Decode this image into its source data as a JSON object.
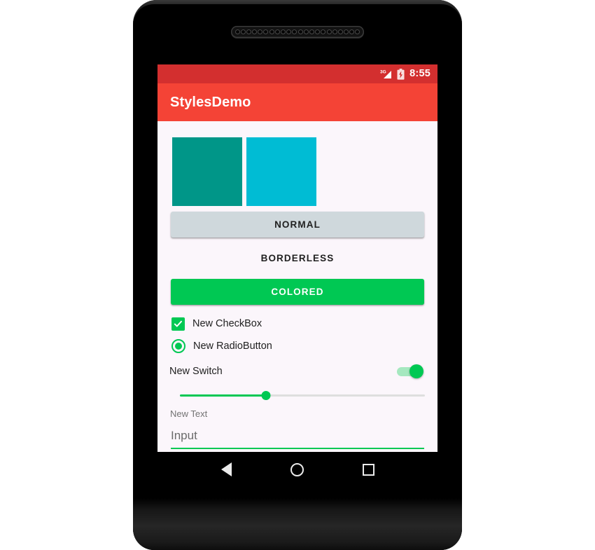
{
  "device": {
    "name": "android-phone-frame",
    "speaker_hole_count": 22
  },
  "status_bar": {
    "network_label": "3G",
    "signal_icon": "signal-bars-icon",
    "battery_icon": "battery-charging-icon",
    "clock": "8:55",
    "background": "#D32F2F"
  },
  "app_bar": {
    "title": "StylesDemo",
    "background": "#F44336",
    "text_color": "#FFFFFF"
  },
  "content": {
    "background": "#FBF6FB",
    "swatches": [
      {
        "name": "teal-swatch",
        "color": "#009688"
      },
      {
        "name": "cyan-swatch",
        "color": "#00BCD4"
      }
    ],
    "buttons": {
      "normal": {
        "label": "NORMAL",
        "background": "#CFD8DC",
        "text_color": "#212121"
      },
      "borderless": {
        "label": "BORDERLESS",
        "background": "transparent",
        "text_color": "#212121"
      },
      "colored": {
        "label": "COLORED",
        "background": "#00C853",
        "text_color": "#FFFFFF"
      }
    },
    "checkbox": {
      "label": "New CheckBox",
      "checked": true,
      "accent": "#00C853"
    },
    "radio": {
      "label": "New RadioButton",
      "selected": true,
      "accent": "#00C853"
    },
    "switch": {
      "label": "New Switch",
      "on": true,
      "accent": "#00C853",
      "track_color": "#A5E8BF"
    },
    "seekbar": {
      "name": "New SeekBar",
      "value_percent": 35,
      "accent": "#00C853",
      "track_color": "#DEDEDE"
    },
    "text_label": "New Text",
    "input": {
      "value": "",
      "placeholder": "Input",
      "underline_color": "#00C853",
      "text_color": "#6B6B6B"
    }
  },
  "nav_bar": {
    "background": "#000000",
    "buttons": [
      {
        "name": "back",
        "icon": "triangle-back-icon"
      },
      {
        "name": "home",
        "icon": "circle-home-icon"
      },
      {
        "name": "recents",
        "icon": "square-recents-icon"
      }
    ]
  }
}
